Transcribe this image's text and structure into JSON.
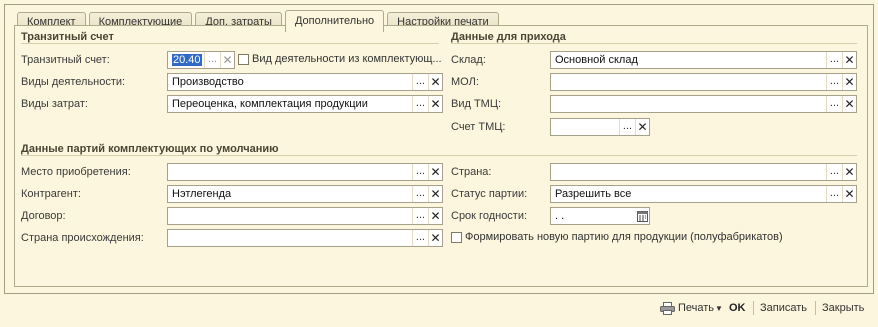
{
  "tabs": [
    {
      "label": "Комплект"
    },
    {
      "label": "Комплектующие"
    },
    {
      "label": "Доп. затраты"
    },
    {
      "label": "Дополнительно"
    },
    {
      "label": "Настройки печати"
    }
  ],
  "transit": {
    "title": "Транзитный счет",
    "account_label": "Транзитный счет:",
    "account_value": "20.40",
    "activity_checkbox_label": "Вид деятельности из комплектующ...",
    "activity_label": "Виды деятельности:",
    "activity_value": "Производство",
    "cost_label": "Виды затрат:",
    "cost_value": "Переоценка, комплектация продукции"
  },
  "income": {
    "title": "Данные для прихода",
    "warehouse_label": "Склад:",
    "warehouse_value": "Основной склад",
    "mol_label": "МОЛ:",
    "mol_value": "",
    "tmc_type_label": "Вид ТМЦ:",
    "tmc_type_value": "",
    "tmc_account_label": "Счет ТМЦ:",
    "tmc_account_value": ""
  },
  "batches": {
    "title": "Данные партий комплектующих по умолчанию",
    "place_label": "Место приобретения:",
    "place_value": "",
    "contractor_label": "Контрагент:",
    "contractor_value": "Нэтлегенда",
    "contract_label": "Договор:",
    "contract_value": "",
    "origin_label": "Страна происхождения:",
    "origin_value": "",
    "country_label": "Страна:",
    "country_value": "",
    "status_label": "Статус партии:",
    "status_value": "Разрешить все",
    "expiry_label": "Срок годности:",
    "expiry_value": " .  .",
    "new_batch_label": "Формировать новую партию для продукции (полуфабрикатов)"
  },
  "buttons": {
    "dots": "...",
    "clear": "✕"
  },
  "commands": {
    "print": "Печать",
    "ok": "OK",
    "save": "Записать",
    "close": "Закрыть"
  },
  "colors": {
    "background": "#fbf6dd",
    "selection": "#316ac5"
  }
}
